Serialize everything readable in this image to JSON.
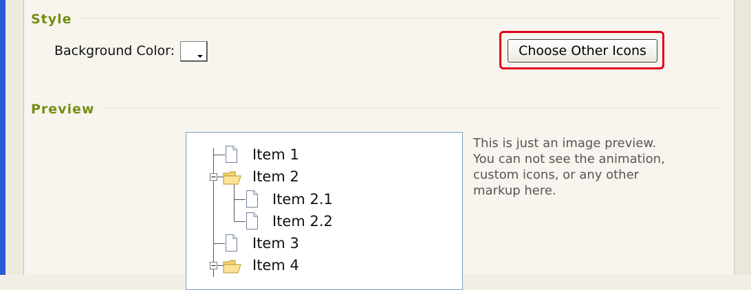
{
  "style_section": {
    "title": "Style",
    "background_color_label": "Background Color:",
    "choose_icons_button": "Choose Other Icons"
  },
  "preview_section": {
    "title": "Preview",
    "tree": [
      {
        "label": "Item 1",
        "type": "file",
        "level": 1
      },
      {
        "label": "Item 2",
        "type": "folder",
        "level": 1,
        "expanded": true
      },
      {
        "label": "Item 2.1",
        "type": "file",
        "level": 2
      },
      {
        "label": "Item 2.2",
        "type": "file",
        "level": 2
      },
      {
        "label": "Item 3",
        "type": "file",
        "level": 1
      },
      {
        "label": "Item 4",
        "type": "folder",
        "level": 1,
        "expanded": true
      }
    ],
    "note_lines": [
      "This is just an image preview.",
      "You can not see the animation,",
      "custom icons, or any other",
      "markup here."
    ]
  },
  "colors": {
    "accent_title": "#758d15",
    "highlight": "#e0001b",
    "window_rail": "#2a5ad7"
  }
}
